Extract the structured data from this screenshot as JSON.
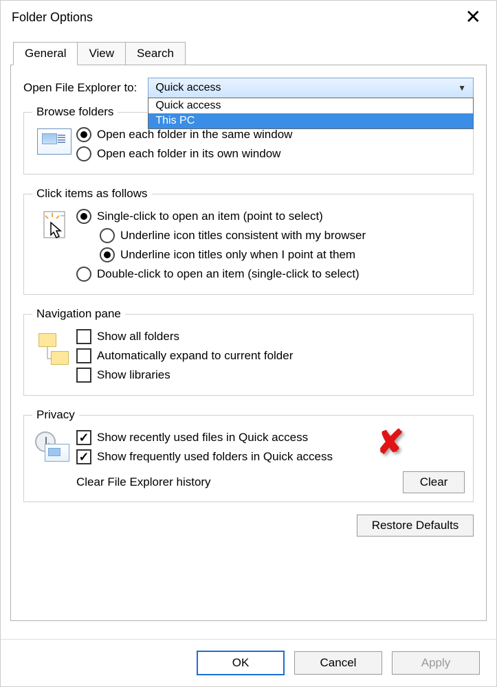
{
  "window_title": "Folder Options",
  "tabs": {
    "general": "General",
    "view": "View",
    "search": "Search"
  },
  "open_to": {
    "label": "Open File Explorer to:",
    "selected": "Quick access",
    "options": [
      "Quick access",
      "This PC"
    ]
  },
  "browse": {
    "legend": "Browse folders",
    "same_window": "Open each folder in the same window",
    "own_window": "Open each folder in its own window"
  },
  "click": {
    "legend": "Click items as follows",
    "single": "Single-click to open an item (point to select)",
    "underline_browser": "Underline icon titles consistent with my browser",
    "underline_point": "Underline icon titles only when I point at them",
    "double": "Double-click to open an item (single-click to select)"
  },
  "nav": {
    "legend": "Navigation pane",
    "show_all": "Show all folders",
    "auto_expand": "Automatically expand to current folder",
    "show_libs": "Show libraries"
  },
  "privacy": {
    "legend": "Privacy",
    "recent_files": "Show recently used files in Quick access",
    "freq_folders": "Show frequently used folders in Quick access",
    "clear_label": "Clear File Explorer history",
    "clear_btn": "Clear"
  },
  "restore_defaults": "Restore Defaults",
  "footer": {
    "ok": "OK",
    "cancel": "Cancel",
    "apply": "Apply"
  }
}
